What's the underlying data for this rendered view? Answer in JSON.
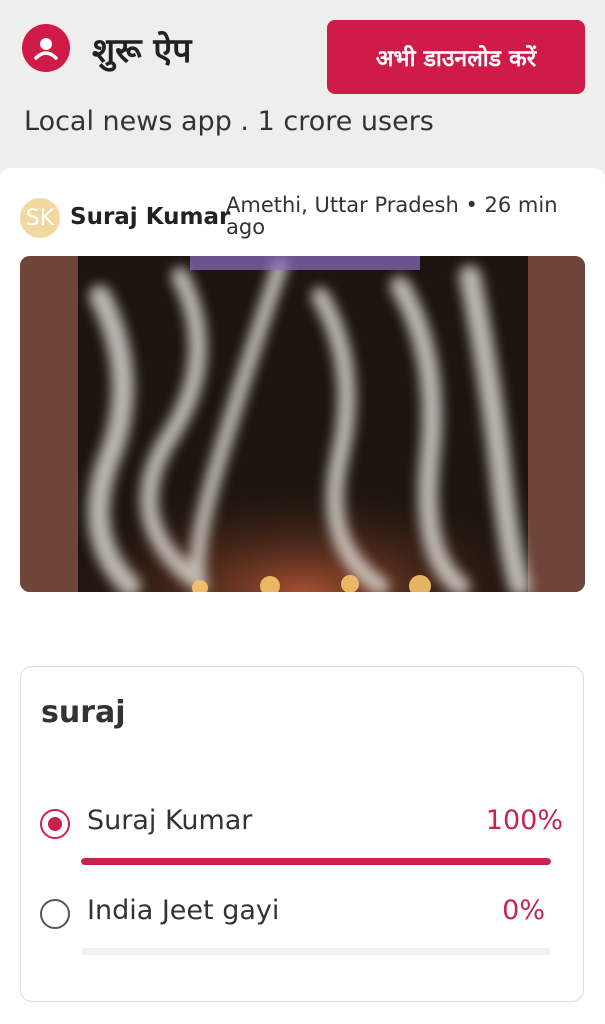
{
  "header": {
    "app_name": "शुरू ऐप",
    "download_label": "अभी डाउनलोड करें",
    "tagline": "Local news app . 1 crore users",
    "brand_color": "#d01a48",
    "logo_icon": "location-pin-user-icon"
  },
  "post": {
    "avatar_initials": "SK",
    "author": "Suraj Kumar",
    "meta": "Amethi, Uttar Pradesh • 26 min ago",
    "media_icon": "fireworks-video-thumbnail"
  },
  "poll": {
    "question": "suraj",
    "options": [
      {
        "label": "Suraj Kumar",
        "percent_text": "100%",
        "percent": 100,
        "selected": true
      },
      {
        "label": "India Jeet gayi",
        "percent_text": "0%",
        "percent": 0,
        "selected": false
      }
    ],
    "accent_color": "#c8234f"
  }
}
